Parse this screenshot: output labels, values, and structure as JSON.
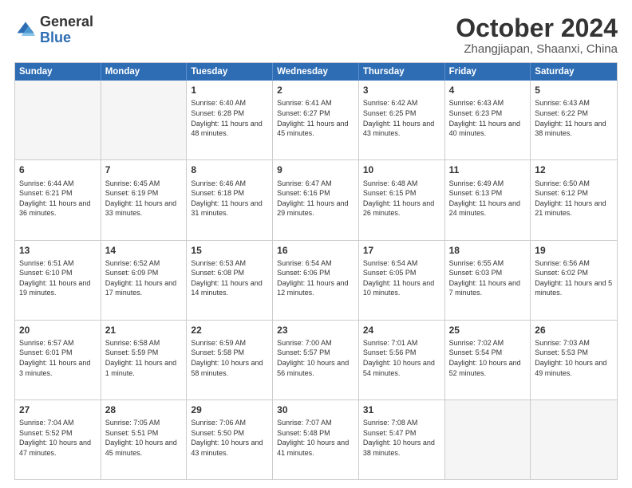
{
  "logo": {
    "general": "General",
    "blue": "Blue"
  },
  "title": "October 2024",
  "location": "Zhangjiapan, Shaanxi, China",
  "days_of_week": [
    "Sunday",
    "Monday",
    "Tuesday",
    "Wednesday",
    "Thursday",
    "Friday",
    "Saturday"
  ],
  "weeks": [
    [
      {
        "day": "",
        "info": "",
        "empty": true
      },
      {
        "day": "",
        "info": "",
        "empty": true
      },
      {
        "day": "1",
        "info": "Sunrise: 6:40 AM\nSunset: 6:28 PM\nDaylight: 11 hours and 48 minutes.",
        "empty": false
      },
      {
        "day": "2",
        "info": "Sunrise: 6:41 AM\nSunset: 6:27 PM\nDaylight: 11 hours and 45 minutes.",
        "empty": false
      },
      {
        "day": "3",
        "info": "Sunrise: 6:42 AM\nSunset: 6:25 PM\nDaylight: 11 hours and 43 minutes.",
        "empty": false
      },
      {
        "day": "4",
        "info": "Sunrise: 6:43 AM\nSunset: 6:23 PM\nDaylight: 11 hours and 40 minutes.",
        "empty": false
      },
      {
        "day": "5",
        "info": "Sunrise: 6:43 AM\nSunset: 6:22 PM\nDaylight: 11 hours and 38 minutes.",
        "empty": false
      }
    ],
    [
      {
        "day": "6",
        "info": "Sunrise: 6:44 AM\nSunset: 6:21 PM\nDaylight: 11 hours and 36 minutes.",
        "empty": false
      },
      {
        "day": "7",
        "info": "Sunrise: 6:45 AM\nSunset: 6:19 PM\nDaylight: 11 hours and 33 minutes.",
        "empty": false
      },
      {
        "day": "8",
        "info": "Sunrise: 6:46 AM\nSunset: 6:18 PM\nDaylight: 11 hours and 31 minutes.",
        "empty": false
      },
      {
        "day": "9",
        "info": "Sunrise: 6:47 AM\nSunset: 6:16 PM\nDaylight: 11 hours and 29 minutes.",
        "empty": false
      },
      {
        "day": "10",
        "info": "Sunrise: 6:48 AM\nSunset: 6:15 PM\nDaylight: 11 hours and 26 minutes.",
        "empty": false
      },
      {
        "day": "11",
        "info": "Sunrise: 6:49 AM\nSunset: 6:13 PM\nDaylight: 11 hours and 24 minutes.",
        "empty": false
      },
      {
        "day": "12",
        "info": "Sunrise: 6:50 AM\nSunset: 6:12 PM\nDaylight: 11 hours and 21 minutes.",
        "empty": false
      }
    ],
    [
      {
        "day": "13",
        "info": "Sunrise: 6:51 AM\nSunset: 6:10 PM\nDaylight: 11 hours and 19 minutes.",
        "empty": false
      },
      {
        "day": "14",
        "info": "Sunrise: 6:52 AM\nSunset: 6:09 PM\nDaylight: 11 hours and 17 minutes.",
        "empty": false
      },
      {
        "day": "15",
        "info": "Sunrise: 6:53 AM\nSunset: 6:08 PM\nDaylight: 11 hours and 14 minutes.",
        "empty": false
      },
      {
        "day": "16",
        "info": "Sunrise: 6:54 AM\nSunset: 6:06 PM\nDaylight: 11 hours and 12 minutes.",
        "empty": false
      },
      {
        "day": "17",
        "info": "Sunrise: 6:54 AM\nSunset: 6:05 PM\nDaylight: 11 hours and 10 minutes.",
        "empty": false
      },
      {
        "day": "18",
        "info": "Sunrise: 6:55 AM\nSunset: 6:03 PM\nDaylight: 11 hours and 7 minutes.",
        "empty": false
      },
      {
        "day": "19",
        "info": "Sunrise: 6:56 AM\nSunset: 6:02 PM\nDaylight: 11 hours and 5 minutes.",
        "empty": false
      }
    ],
    [
      {
        "day": "20",
        "info": "Sunrise: 6:57 AM\nSunset: 6:01 PM\nDaylight: 11 hours and 3 minutes.",
        "empty": false
      },
      {
        "day": "21",
        "info": "Sunrise: 6:58 AM\nSunset: 5:59 PM\nDaylight: 11 hours and 1 minute.",
        "empty": false
      },
      {
        "day": "22",
        "info": "Sunrise: 6:59 AM\nSunset: 5:58 PM\nDaylight: 10 hours and 58 minutes.",
        "empty": false
      },
      {
        "day": "23",
        "info": "Sunrise: 7:00 AM\nSunset: 5:57 PM\nDaylight: 10 hours and 56 minutes.",
        "empty": false
      },
      {
        "day": "24",
        "info": "Sunrise: 7:01 AM\nSunset: 5:56 PM\nDaylight: 10 hours and 54 minutes.",
        "empty": false
      },
      {
        "day": "25",
        "info": "Sunrise: 7:02 AM\nSunset: 5:54 PM\nDaylight: 10 hours and 52 minutes.",
        "empty": false
      },
      {
        "day": "26",
        "info": "Sunrise: 7:03 AM\nSunset: 5:53 PM\nDaylight: 10 hours and 49 minutes.",
        "empty": false
      }
    ],
    [
      {
        "day": "27",
        "info": "Sunrise: 7:04 AM\nSunset: 5:52 PM\nDaylight: 10 hours and 47 minutes.",
        "empty": false
      },
      {
        "day": "28",
        "info": "Sunrise: 7:05 AM\nSunset: 5:51 PM\nDaylight: 10 hours and 45 minutes.",
        "empty": false
      },
      {
        "day": "29",
        "info": "Sunrise: 7:06 AM\nSunset: 5:50 PM\nDaylight: 10 hours and 43 minutes.",
        "empty": false
      },
      {
        "day": "30",
        "info": "Sunrise: 7:07 AM\nSunset: 5:48 PM\nDaylight: 10 hours and 41 minutes.",
        "empty": false
      },
      {
        "day": "31",
        "info": "Sunrise: 7:08 AM\nSunset: 5:47 PM\nDaylight: 10 hours and 38 minutes.",
        "empty": false
      },
      {
        "day": "",
        "info": "",
        "empty": true
      },
      {
        "day": "",
        "info": "",
        "empty": true
      }
    ]
  ]
}
